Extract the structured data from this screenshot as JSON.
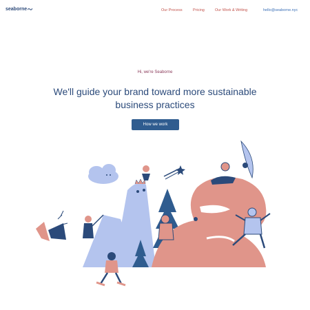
{
  "brand": {
    "name": "seaborne"
  },
  "nav": {
    "items": [
      "Our Process",
      "Pricing",
      "Our Work & Writing"
    ],
    "email": "hello@seaborne.nyc"
  },
  "hero": {
    "greeting": "Hi, we're Seaborne",
    "headline_line1": "We'll guide your brand toward more sustainable",
    "headline_line2": "business practices",
    "cta_label": "How we work"
  },
  "colors": {
    "navy": "#2b4a7a",
    "coral": "#e0958a",
    "periwinkle": "#b4c4ee",
    "button": "#2f5c8f"
  },
  "icons": [
    "wave-icon"
  ]
}
